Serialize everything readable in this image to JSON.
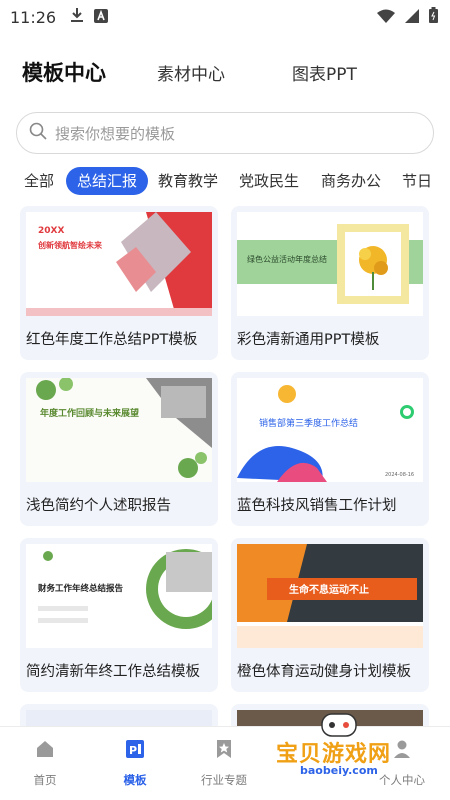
{
  "status": {
    "time": "11:26",
    "icons": [
      "download-icon",
      "notification-a-icon",
      "wifi-icon",
      "signal-icon",
      "battery-icon"
    ]
  },
  "top_tabs": [
    {
      "label": "模板中心",
      "active": true
    },
    {
      "label": "素材中心",
      "active": false
    },
    {
      "label": "图表PPT",
      "active": false
    }
  ],
  "search": {
    "placeholder": "搜索你想要的模板"
  },
  "categories": [
    {
      "label": "全部"
    },
    {
      "label": "总结汇报",
      "active": true
    },
    {
      "label": "教育教学"
    },
    {
      "label": "党政民生"
    },
    {
      "label": "商务办公"
    },
    {
      "label": "节日"
    }
  ],
  "cards": [
    {
      "title": "红色年度工作总结PPT模板",
      "thumb_year": "20XX",
      "thumb_heading": "创新领航智绘未来"
    },
    {
      "title": "彩色清新通用PPT模板",
      "thumb_heading": "绿色公益活动年度总结"
    },
    {
      "title": "浅色简约个人述职报告",
      "thumb_heading": "年度工作回顾与未来展望"
    },
    {
      "title": "蓝色科技风销售工作计划",
      "thumb_heading": "销售部第三季度工作总结",
      "thumb_date": "2024-08-16"
    },
    {
      "title": "简约清新年终工作总结模板",
      "thumb_heading": "财务工作年终总结报告"
    },
    {
      "title": "橙色体育运动健身计划模板",
      "thumb_heading": "生命不息运动不止"
    }
  ],
  "bottom_nav": [
    {
      "label": "首页",
      "icon": "home-icon"
    },
    {
      "label": "模板",
      "icon": "template-icon",
      "active": true
    },
    {
      "label": "行业专题",
      "icon": "bookmark-icon"
    },
    {
      "label": "个人中心",
      "icon": "person-icon"
    }
  ],
  "watermark": {
    "text": "宝贝游戏网",
    "url_text": "baobeiy.com"
  },
  "colors": {
    "accent": "#2d63e8",
    "red": "#e0393e",
    "green": "#6aa84f",
    "orange": "#f08a24"
  }
}
